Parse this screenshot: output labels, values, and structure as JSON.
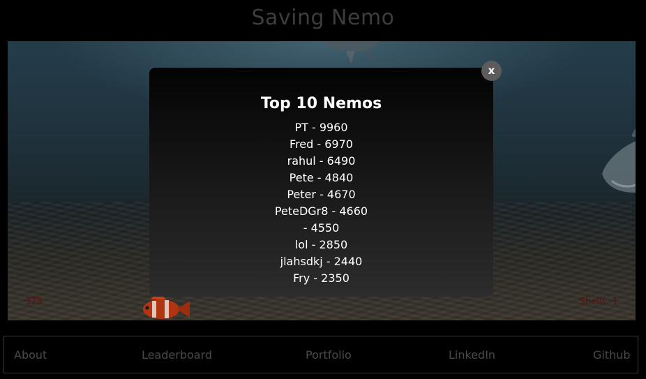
{
  "game": {
    "title": "Saving Nemo",
    "hud": {
      "score": "375",
      "shells": "Shells: 1"
    }
  },
  "leaderboard_modal": {
    "title": "Top 10 Nemos",
    "close_label": "x",
    "entries": [
      "PT - 9960",
      "Fred - 6970",
      "rahul - 6490",
      "Pete - 4840",
      "Peter - 4670",
      "PeteDGr8 - 4660",
      " - 4550",
      "lol - 2850",
      "jlahsdkj - 2440",
      "Fry - 2350"
    ]
  },
  "nav": {
    "about": "About",
    "leaderboard": "Leaderboard",
    "portfolio": "Portfolio",
    "linkedin": "LinkedIn",
    "github": "Github"
  },
  "colors": {
    "background": "#000000",
    "title_text": "#3d3d3d",
    "hud_text": "#5a1010",
    "nav_text": "#4a4a4a",
    "close_button": "#5c5c5c"
  }
}
